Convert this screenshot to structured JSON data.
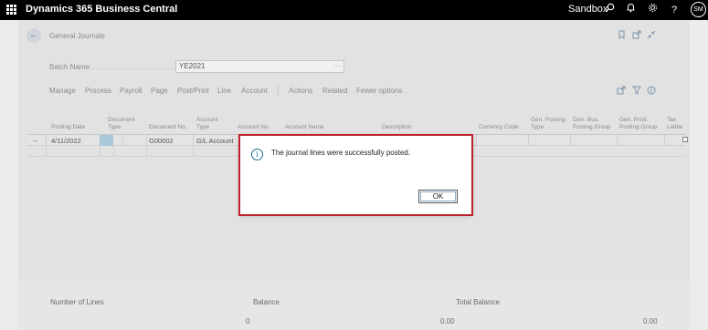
{
  "appbar": {
    "title": "Dynamics 365 Business Central",
    "environment": "Sandbox",
    "avatar_initials": "SM",
    "icons": [
      "waffle-icon",
      "search-icon",
      "bell-icon",
      "gear-icon",
      "help-icon"
    ]
  },
  "page": {
    "title": "General Journals",
    "batch_name_label": "Batch Name",
    "batch_name_value": "YE2021",
    "batch_more": "···"
  },
  "actions": [
    "Manage",
    "Process",
    "Payroll",
    "Page",
    "Post/Print",
    "Line",
    "Account",
    "Actions",
    "Related",
    "Fewer options"
  ],
  "grid": {
    "columns": [
      "Posting Date",
      "Document Type",
      "Document No.",
      "Account Type",
      "Account No.",
      "Account Name",
      "Description",
      "Currency Code",
      "Gen. Posting Type",
      "Gen. Bus. Posting Group",
      "Gen. Prod. Posting Group",
      "Tax Liable"
    ],
    "row": {
      "arrow": "→",
      "posting_date": "4/11/2022",
      "document_no": "G00002",
      "account_type": "G/L Account"
    }
  },
  "footer": {
    "number_of_lines_label": "Number of Lines",
    "balance_label": "Balance",
    "total_balance_label": "Total Balance",
    "number_of_lines_value": "0",
    "balance_value": "0.00",
    "total_balance_value": "0.00"
  },
  "dialog": {
    "icon": "info-icon",
    "message": "The journal lines were successfully posted.",
    "ok_label": "OK",
    "highlight_color": "#c0202a"
  }
}
